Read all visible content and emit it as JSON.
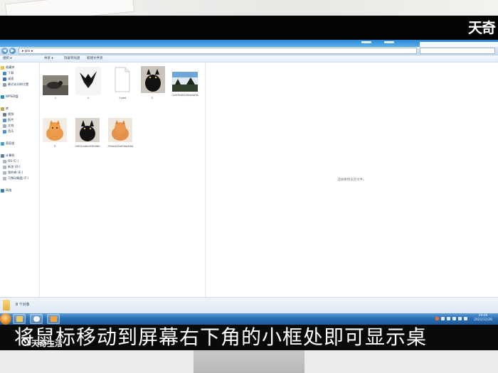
{
  "video": {
    "brand_logo": "天奇",
    "subtitle": "将鼠标移动到屏幕右下角的小框处即可显示桌",
    "watermark": "天奇生活"
  },
  "explorer": {
    "address_path": "▸ pic ▸",
    "toolbar": [
      {
        "label": "组织 ▾"
      },
      {
        "label": "共享 ▾"
      },
      {
        "label": "刻录到光盘"
      },
      {
        "label": "新建文件夹"
      }
    ],
    "nav": {
      "favorites": "收藏夹",
      "downloads": "下载",
      "desktop": "桌面",
      "recent": "最近访问的位置",
      "wps": "WPS网盘",
      "libraries": "库",
      "videos": "视频",
      "pictures": "图片",
      "documents": "文档",
      "music": "音乐",
      "homegroup": "家庭组",
      "computer": "计算机",
      "drive_c": "OS (C:)",
      "drive_d": "新加 (D:)",
      "drive_e": "我的卷 (E:)",
      "drive_f": "可移动磁盘 (F:)",
      "network": "网络"
    },
    "files": [
      {
        "name": "1",
        "type": "bird"
      },
      {
        "name": "1",
        "type": "black-bird"
      },
      {
        "name": "1.psd",
        "type": "document"
      },
      {
        "name": "2",
        "type": "black-cat"
      },
      {
        "name": "-2a53b46320be4d3b",
        "type": "landscape"
      },
      {
        "name": "3",
        "type": "orange-cat"
      },
      {
        "name": "5d53cbdba93fd46d",
        "type": "black-cat"
      },
      {
        "name": "-59bb262a90ba4feb",
        "type": "orange-cat"
      }
    ],
    "preview_message": "选择要预览的文件。",
    "status": "8 个对象"
  },
  "taskbar": {
    "time": "19:06",
    "date": "2021/12/26"
  }
}
